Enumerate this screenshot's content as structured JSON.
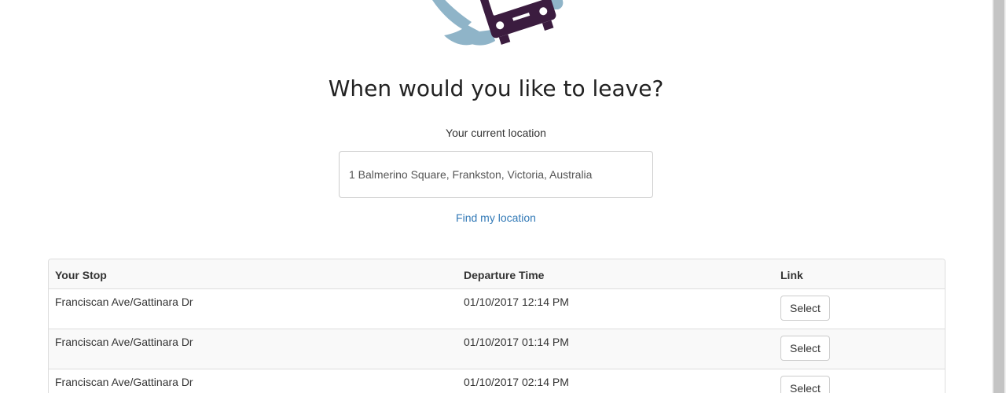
{
  "logo": {
    "icon": "bus-hand-logo-icon",
    "colors": {
      "hand": "#8fb4c8",
      "bus": "#3b1c3f"
    }
  },
  "heading": "When would you like to leave?",
  "location": {
    "label": "Your current location",
    "value": "1 Balmerino Square, Frankston, Victoria, Australia",
    "find_link": "Find my location"
  },
  "table": {
    "headers": {
      "stop": "Your Stop",
      "time": "Departure Time",
      "link": "Link"
    },
    "rows": [
      {
        "stop": "Franciscan Ave/Gattinara Dr",
        "time": "01/10/2017 12:14 PM",
        "button": "Select"
      },
      {
        "stop": "Franciscan Ave/Gattinara Dr",
        "time": "01/10/2017 01:14 PM",
        "button": "Select"
      },
      {
        "stop": "Franciscan Ave/Gattinara Dr",
        "time": "01/10/2017 02:14 PM",
        "button": "Select"
      }
    ]
  },
  "colors": {
    "link": "#337ab7",
    "border": "#dddddd",
    "stripe": "#f9f9f9"
  }
}
